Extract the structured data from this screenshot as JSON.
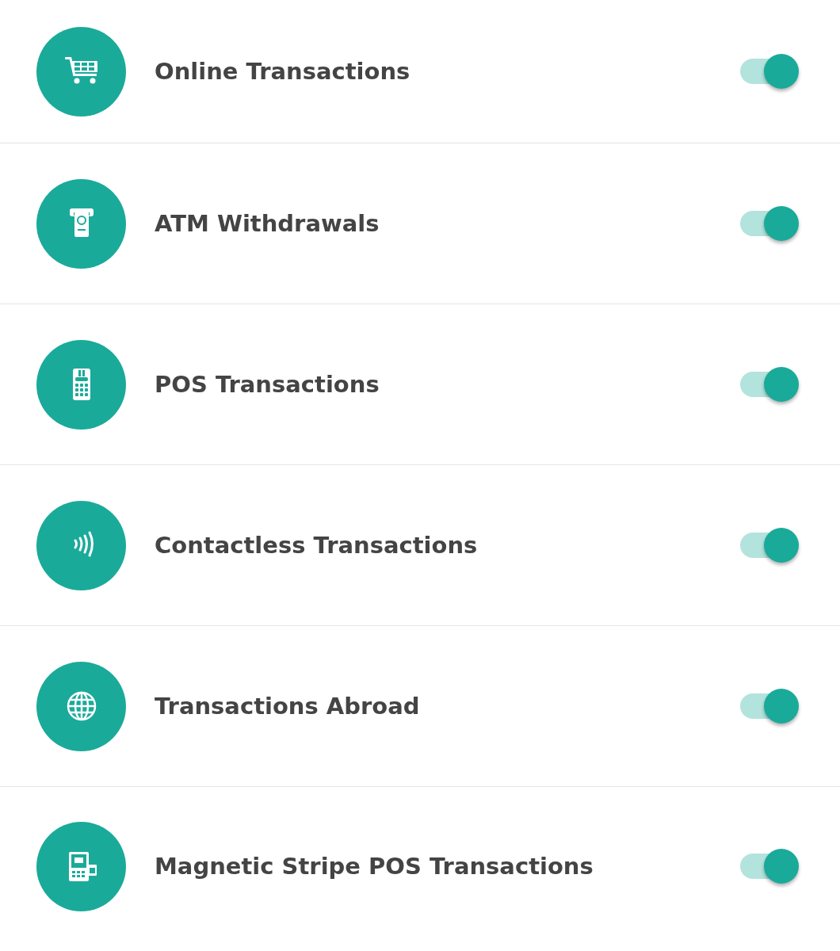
{
  "settings": [
    {
      "kind": "cart",
      "label": "Online Transactions",
      "on": true
    },
    {
      "kind": "atm",
      "label": "ATM Withdrawals",
      "on": true
    },
    {
      "kind": "pos",
      "label": "POS Transactions",
      "on": true
    },
    {
      "kind": "contactless",
      "label": "Contactless Transactions",
      "on": true
    },
    {
      "kind": "globe",
      "label": "Transactions Abroad",
      "on": true
    },
    {
      "kind": "terminal",
      "label": "Magnetic Stripe POS Transactions",
      "on": true
    }
  ]
}
